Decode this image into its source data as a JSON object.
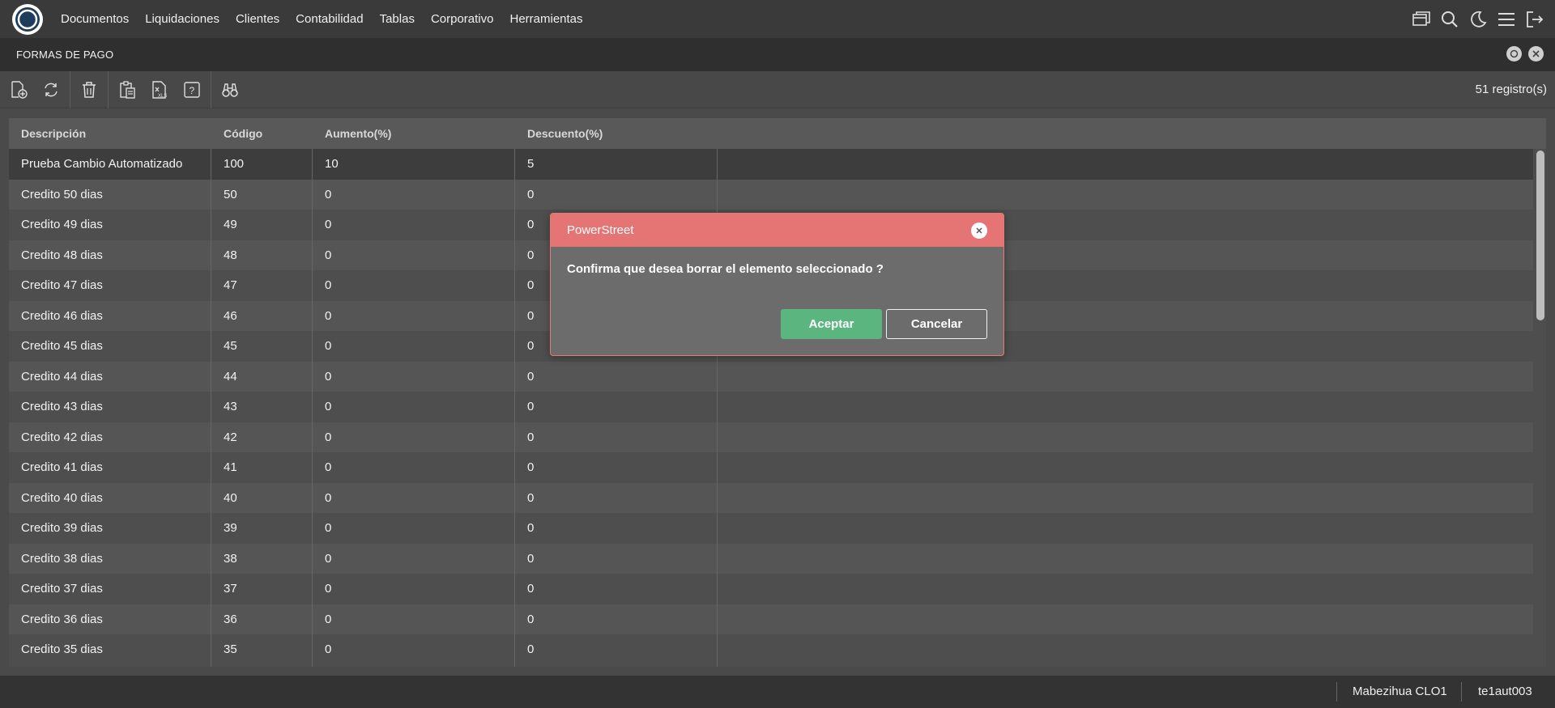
{
  "nav": {
    "menu": [
      "Documentos",
      "Liquidaciones",
      "Clientes",
      "Contabilidad",
      "Tablas",
      "Corporativo",
      "Herramientas"
    ],
    "icons": [
      "windows-icon",
      "search-icon",
      "moon-icon",
      "hamburger-icon",
      "logout-icon"
    ]
  },
  "page": {
    "title": "FORMAS DE PAGO"
  },
  "toolbar": {
    "record_count": "51 registro(s)"
  },
  "table": {
    "columns": [
      "Descripción",
      "Código",
      "Aumento(%)",
      "Descuento(%)"
    ],
    "rows": [
      [
        "Prueba Cambio Automatizado",
        "100",
        "10",
        "5"
      ],
      [
        "Credito 50 dias",
        "50",
        "0",
        "0"
      ],
      [
        "Credito 49 dias",
        "49",
        "0",
        "0"
      ],
      [
        "Credito 48 dias",
        "48",
        "0",
        "0"
      ],
      [
        "Credito 47 dias",
        "47",
        "0",
        "0"
      ],
      [
        "Credito 46 dias",
        "46",
        "0",
        "0"
      ],
      [
        "Credito 45 dias",
        "45",
        "0",
        "0"
      ],
      [
        "Credito 44 dias",
        "44",
        "0",
        "0"
      ],
      [
        "Credito 43 dias",
        "43",
        "0",
        "0"
      ],
      [
        "Credito 42 dias",
        "42",
        "0",
        "0"
      ],
      [
        "Credito 41 dias",
        "41",
        "0",
        "0"
      ],
      [
        "Credito 40 dias",
        "40",
        "0",
        "0"
      ],
      [
        "Credito 39 dias",
        "39",
        "0",
        "0"
      ],
      [
        "Credito 38 dias",
        "38",
        "0",
        "0"
      ],
      [
        "Credito 37 dias",
        "37",
        "0",
        "0"
      ],
      [
        "Credito 36 dias",
        "36",
        "0",
        "0"
      ],
      [
        "Credito 35 dias",
        "35",
        "0",
        "0"
      ]
    ]
  },
  "status": {
    "user": "Mabezihua CLO1",
    "session": "te1aut003"
  },
  "dialog": {
    "title": "PowerStreet",
    "message": "Confirma que desea borrar el elemento seleccionado ?",
    "accept_label": "Aceptar",
    "cancel_label": "Cancelar"
  },
  "colors": {
    "dialog_header": "#e57575",
    "accept_button": "#5bb57f",
    "topnav": "#3a3a3a",
    "titlebar": "#2f2f2f"
  }
}
